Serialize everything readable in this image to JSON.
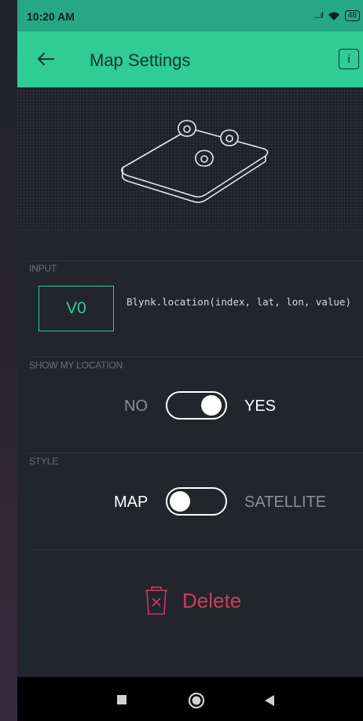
{
  "status_bar": {
    "time": "10:20 AM",
    "signal": "....ıl",
    "battery": "48"
  },
  "app_bar": {
    "title": "Map Settings",
    "info_label": "i"
  },
  "input_section": {
    "label": "INPUT",
    "pin": "V0",
    "description": "Blynk.location(index, lat, lon, value)"
  },
  "show_location": {
    "label": "SHOW MY LOCATION",
    "off_label": "NO",
    "on_label": "YES",
    "enabled": true
  },
  "style": {
    "label": "STYLE",
    "left_label": "MAP",
    "right_label": "SATELLITE",
    "selected": "MAP"
  },
  "delete": {
    "label": "Delete"
  },
  "colors": {
    "accent": "#2fcc96",
    "status_bar": "#26a886",
    "delete": "#c83e5e",
    "background": "#23252c"
  },
  "icons": {
    "back": "arrow-left-icon",
    "info": "info-icon",
    "delete": "trash-icon",
    "nav": [
      "square-recents-icon",
      "circle-home-icon",
      "triangle-back-icon"
    ]
  }
}
